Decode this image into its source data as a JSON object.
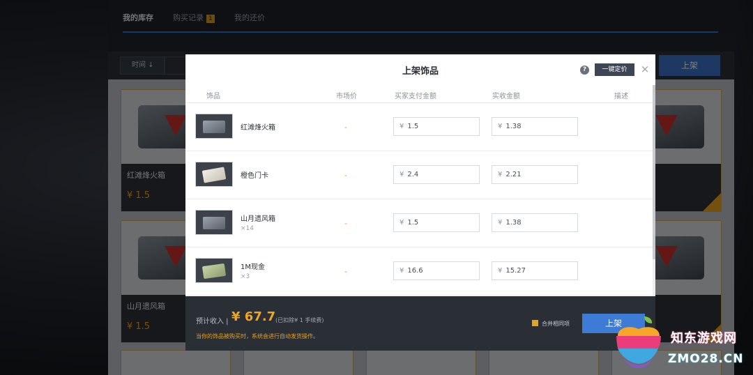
{
  "nav": {
    "tabs": [
      {
        "label": "我的库存"
      },
      {
        "label": "购买记录",
        "badge": "1"
      },
      {
        "label": "我的还价"
      }
    ]
  },
  "toolbar": {
    "sort_label": "时间 ↓",
    "list_button": "上架"
  },
  "background_cards": [
    {
      "name": "红滩烽火箱",
      "price": "¥ 1.5"
    },
    {
      "name": "山月遗风箱",
      "price": "¥ 1.5"
    }
  ],
  "modal": {
    "title": "上架饰品",
    "help_icon": "?",
    "auto_price_button": "一键定价",
    "close_icon": "×",
    "columns": [
      "饰品",
      "市场价",
      "买家支付金额",
      "实收金额",
      "描述"
    ],
    "items": [
      {
        "name": "红滩烽火箱",
        "qty": "",
        "market": "-",
        "pay": "1.5",
        "receive": "1.38",
        "icon": "crate-icon"
      },
      {
        "name": "橙色门卡",
        "qty": "",
        "market": "-",
        "pay": "2.4",
        "receive": "2.21",
        "icon": "keycard-icon"
      },
      {
        "name": "山月遗风箱",
        "qty": "×14",
        "market": "-",
        "pay": "1.5",
        "receive": "1.38",
        "icon": "crate-icon"
      },
      {
        "name": "1M现金",
        "qty": "×3",
        "market": "-",
        "pay": "16.6",
        "receive": "15.27",
        "icon": "cash-icon"
      }
    ],
    "currency": "¥",
    "footer": {
      "label": "预计收入 |",
      "amount": "¥ 67.7",
      "fee_note": "(已扣除¥ 1 手续费)",
      "auto_note": "当你的饰品被购买时，系统会进行自动发货操作。",
      "merge_label": "合并相同项",
      "submit": "上架"
    }
  },
  "watermark": {
    "text_cn": "知东游戏网",
    "text_en": "ZMO28.CN"
  },
  "colors": {
    "accent_orange": "#e8a21d",
    "primary_blue": "#3d7bd6",
    "footer_bg": "#2a2e35"
  }
}
